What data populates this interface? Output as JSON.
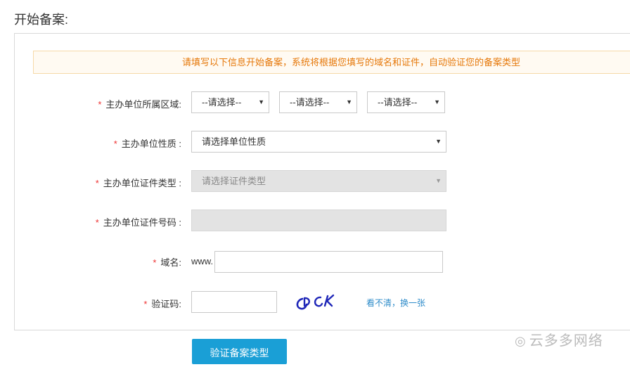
{
  "page": {
    "title": "开始备案:"
  },
  "notice": {
    "text": "请填写以下信息开始备案，系统将根据您填写的域名和证件，自动验证您的备案类型"
  },
  "form": {
    "region": {
      "label": "主办单位所属区域:",
      "required_mark": "*",
      "selects": [
        "--请选择--",
        "--请选择--",
        "--请选择--"
      ]
    },
    "nature": {
      "label": "主办单位性质 :",
      "required_mark": "*",
      "value": "请选择单位性质"
    },
    "cert_type": {
      "label": "主办单位证件类型 :",
      "required_mark": "*",
      "value": "请选择证件类型",
      "disabled": true
    },
    "cert_number": {
      "label": "主办单位证件号码 :",
      "required_mark": "*",
      "value": "",
      "disabled": true
    },
    "domain": {
      "label": "域名:",
      "required_mark": "*",
      "prefix": "www.",
      "value": ""
    },
    "captcha": {
      "label": "验证码:",
      "required_mark": "*",
      "value": "",
      "image_text": "CDCK",
      "refresh_text": "看不清，换一张"
    }
  },
  "submit_button": {
    "label": "验证备案类型"
  },
  "watermark": {
    "text": "云多多网络"
  },
  "colors": {
    "accent": "#1a9fd6",
    "notice_text": "#e6780a",
    "required": "#e33333"
  }
}
